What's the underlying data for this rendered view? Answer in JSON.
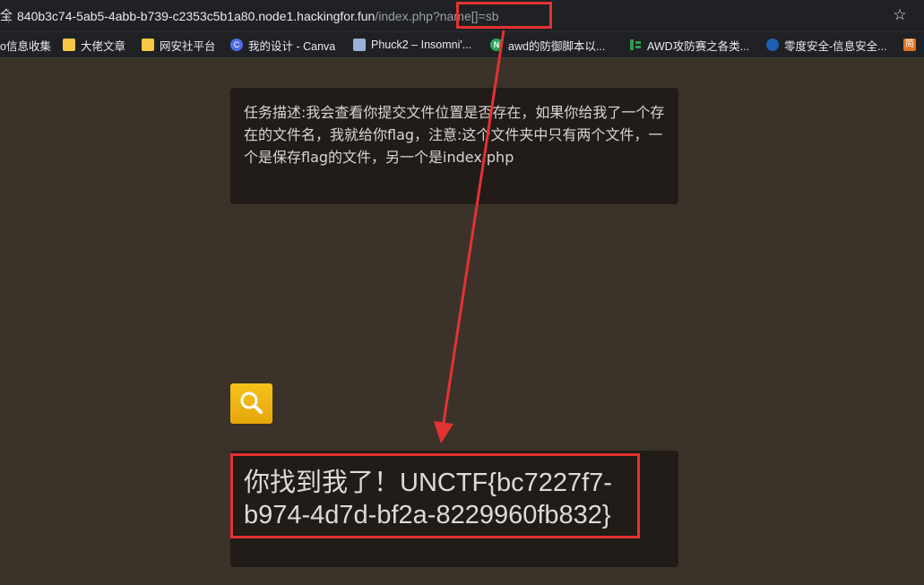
{
  "browser": {
    "url_edge": "全",
    "url_host": "840b3c74-5ab5-4abb-b739-c2353c5b1a80.node1.hackingfor.fun",
    "url_path": "/index.php",
    "url_query": "?name[]=sb",
    "star_icon": "star-icon"
  },
  "bookmarks": [
    {
      "label": "o信息收集",
      "icon": "none"
    },
    {
      "label": "大佬文章",
      "icon": "folder-icon"
    },
    {
      "label": "网安社平台",
      "icon": "folder-icon"
    },
    {
      "label": "我的设计 - Canva",
      "icon": "canva-icon"
    },
    {
      "label": "Phuck2 – Insomni'...",
      "icon": "document-icon"
    },
    {
      "label": "awd的防御脚本以...",
      "icon": "n-icon"
    },
    {
      "label": "AWD攻防赛之各类...",
      "icon": "green-logo-icon"
    },
    {
      "label": "零度安全-信息安全...",
      "icon": "globe-icon"
    },
    {
      "label": "简",
      "icon": "orange-icon"
    }
  ],
  "page": {
    "description": "任务描述:我会查看你提交文件位置是否存在，如果你给我了一个存在的文件名，我就给你flag，注意:这个文件夹中只有两个文件，一个是保存flag的文件，另一个是index.php",
    "search_icon": "search-icon",
    "result": "你找到我了！UNCTF{bc7227f7-b974-4d7d-bf2a-8229960fb832}"
  },
  "annotations": {
    "highlight_color": "#e33232"
  }
}
